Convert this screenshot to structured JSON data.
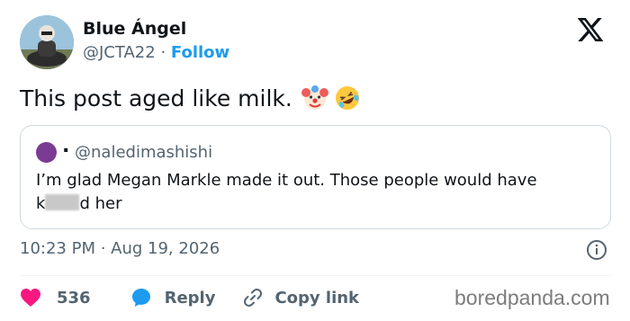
{
  "author": {
    "name": "Blue Ángel",
    "handle": "@JCTA22",
    "separator": "·",
    "follow_label": "Follow"
  },
  "tweet": {
    "text": "This post aged like milk.",
    "emojis": [
      "clown-face",
      "rolling-on-floor-laughing"
    ]
  },
  "quoted_tweet": {
    "display_name": ".",
    "handle": "@naledimashishi",
    "text_line1": "I’m glad Megan Markle made it out. Those people would have",
    "text_line2_prefix": "k",
    "text_line2_suffix": "d her"
  },
  "meta": {
    "timestamp": "10:23 PM · Aug 19, 2026"
  },
  "actions": {
    "likes": "536",
    "reply_label": "Reply",
    "copy_label": "Copy link"
  },
  "watermark": "boredpanda.com",
  "colors": {
    "link": "#1d9bf0",
    "like": "#f91880",
    "text": "#0f1419",
    "muted": "#536471",
    "border": "#cfd9de"
  }
}
